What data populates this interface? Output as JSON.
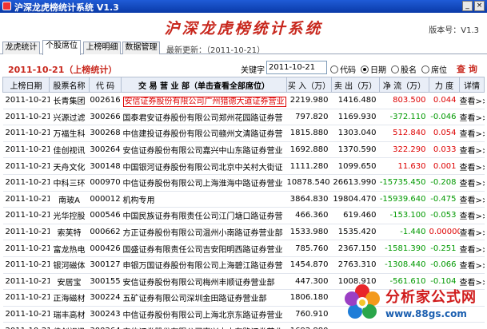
{
  "window": {
    "title": "沪深龙虎榜统计系统  V1.3",
    "minimize_glyph": "_",
    "close_glyph": "×"
  },
  "header": {
    "title": "沪深龙虎榜统计系统",
    "version": "版本号：V1.3"
  },
  "tabs": [
    {
      "label": "龙虎统计"
    },
    {
      "label": "个股席位"
    },
    {
      "label": "上榜明细"
    },
    {
      "label": "数据管理"
    }
  ],
  "update_info": "最新更新：（2011-10-21）",
  "filter": {
    "date_label": "2011-10-21（上榜统计）",
    "keyword_label": "关键字",
    "keyword_value": "2011-10-21",
    "radios": [
      {
        "label": "代码",
        "selected": false
      },
      {
        "label": "日期",
        "selected": true
      },
      {
        "label": "股名",
        "selected": false
      },
      {
        "label": "席位",
        "selected": false
      }
    ],
    "query_label": "查 询"
  },
  "table": {
    "headers": [
      "上榜日期",
      "股票名称",
      "代 码",
      "交 易 营 业 部（单击查看全部席位）",
      "买 入（万）",
      "卖 出（万）",
      "净 流（万）",
      "力 度",
      "详情"
    ],
    "rows": [
      {
        "date": "2011-10-21",
        "name": "长青集团",
        "code": "002616",
        "branch": "安信证券股份有限公司广州猎德大道证券营业",
        "buy": "2219.980",
        "sell": "1416.480",
        "net": "803.500",
        "power": "0.044",
        "detail": "查看>>",
        "boxed": true
      },
      {
        "date": "2011-10-21",
        "name": "兴源过滤",
        "code": "300266",
        "branch": "国泰君安证券股份有限公司郑州花园路证券营",
        "buy": "797.820",
        "sell": "1169.930",
        "net": "-372.110",
        "power": "-0.046",
        "detail": "查看>>"
      },
      {
        "date": "2011-10-21",
        "name": "万福生科",
        "code": "300268",
        "branch": "中信建投证券股份有限公司赣州文清路证券营",
        "buy": "1815.880",
        "sell": "1303.040",
        "net": "512.840",
        "power": "0.054",
        "detail": "查看>>"
      },
      {
        "date": "2011-10-21",
        "name": "佳创视讯",
        "code": "300264",
        "branch": "安信证券股份有限公司嘉兴中山东路证券营业",
        "buy": "1692.880",
        "sell": "1370.590",
        "net": "322.290",
        "power": "0.033",
        "detail": "查看>>"
      },
      {
        "date": "2011-10-21",
        "name": "天舟文化",
        "code": "300148",
        "branch": "中国银河证券股份有限公司北京中关村大街证",
        "buy": "1111.280",
        "sell": "1099.650",
        "net": "11.630",
        "power": "0.001",
        "detail": "查看>>"
      },
      {
        "date": "2011-10-21",
        "name": "中科三环",
        "code": "000970",
        "branch": "中信证券股份有限公司上海淮海中路证券营业",
        "buy": "10878.540",
        "sell": "26613.990",
        "net": "-15735.450",
        "power": "-0.208",
        "detail": "查看>>"
      },
      {
        "date": "2011-10-21",
        "name": "南玻A",
        "code": "000012",
        "branch": "机构专用",
        "buy": "3864.830",
        "sell": "19804.470",
        "net": "-15939.640",
        "power": "-0.475",
        "detail": "查看>>"
      },
      {
        "date": "2011-10-21",
        "name": "光华控股",
        "code": "000546",
        "branch": "中国民族证券有限责任公司江门塘口路证券营",
        "buy": "466.360",
        "sell": "619.460",
        "net": "-153.100",
        "power": "-0.053",
        "detail": "查看>>"
      },
      {
        "date": "2011-10-21",
        "name": "索芙特",
        "code": "000662",
        "branch": "方正证券股份有限公司温州小南路证券营业部",
        "buy": "1533.980",
        "sell": "1535.420",
        "net": "-1.440",
        "power": "0.00000",
        "detail": "查看>>"
      },
      {
        "date": "2011-10-21",
        "name": "富龙热电",
        "code": "000426",
        "branch": "国盛证券有限责任公司吉安阳明西路证券营业",
        "buy": "785.760",
        "sell": "2367.150",
        "net": "-1581.390",
        "power": "-0.251",
        "detail": "查看>>"
      },
      {
        "date": "2011-10-21",
        "name": "银河磁体",
        "code": "300127",
        "branch": "申银万国证券股份有限公司上海碧江路证券营",
        "buy": "1454.870",
        "sell": "2763.310",
        "net": "-1308.440",
        "power": "-0.066",
        "detail": "查看>>"
      },
      {
        "date": "2011-10-21",
        "name": "安居宝",
        "code": "300155",
        "branch": "安信证券股份有限公司梅州丰顺证券营业部",
        "buy": "447.300",
        "sell": "1008.910",
        "net": "-561.610",
        "power": "-0.104",
        "detail": "查看>>"
      },
      {
        "date": "2011-10-21",
        "name": "正海磁材",
        "code": "300224",
        "branch": "五矿证券有限公司深圳金田路证券营业部",
        "buy": "1806.180",
        "sell": "",
        "net": "",
        "power": "",
        "detail": ""
      },
      {
        "date": "2011-10-21",
        "name": "瑞丰高材",
        "code": "300243",
        "branch": "中信证券股份有限公司上海北京东路证券营业",
        "buy": "760.910",
        "sell": "",
        "net": "",
        "power": "",
        "detail": ""
      },
      {
        "date": "2011-10-21",
        "name": "佳创视讯",
        "code": "300264",
        "branch": "安信证券股份有限公司嘉兴中山东路证券营业",
        "buy": "1692.880",
        "sell": "",
        "net": "",
        "power": "",
        "detail": ""
      }
    ]
  },
  "watermark": {
    "text": "分析家公式网",
    "url": "www.88gs.com"
  }
}
